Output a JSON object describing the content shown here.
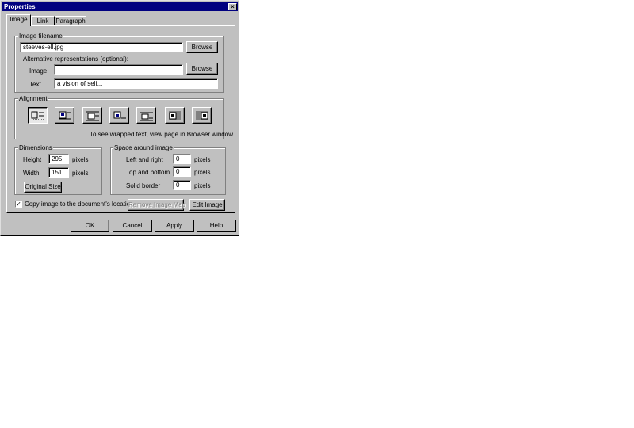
{
  "window": {
    "title": "Properties",
    "close_glyph": "×"
  },
  "tabs": [
    {
      "label": "Image"
    },
    {
      "label": "Link"
    },
    {
      "label": "Paragraph"
    }
  ],
  "filename_group": {
    "legend": "Image filename",
    "filename_value": "steeves-ell.jpg",
    "browse_label": "Browse",
    "alt_heading": "Alternative representations (optional):",
    "alt_image_label": "Image",
    "alt_image_value": "",
    "alt_browse_label": "Browse",
    "alt_text_label": "Text",
    "alt_text_value": "a vision of self..."
  },
  "alignment_group": {
    "legend": "Alignment",
    "buttons": [
      {
        "icon": "align-text-wrap-icon"
      },
      {
        "icon": "align-top-icon"
      },
      {
        "icon": "align-middle-icon"
      },
      {
        "icon": "align-bottom-icon"
      },
      {
        "icon": "align-baseline-icon"
      },
      {
        "icon": "align-left-wrap-icon"
      },
      {
        "icon": "align-right-wrap-icon"
      }
    ],
    "note": "To see wrapped text, view page in Browser window."
  },
  "dimensions_group": {
    "legend": "Dimensions",
    "height_label": "Height",
    "height_value": "295",
    "width_label": "Width",
    "width_value": "151",
    "unit": "pixels",
    "original_size_label": "Original Size"
  },
  "space_group": {
    "legend": "Space around image",
    "left_right_label": "Left and right",
    "left_right_value": "0",
    "top_bottom_label": "Top and bottom",
    "top_bottom_value": "0",
    "border_label": "Solid border",
    "border_value": "0",
    "unit": "pixels"
  },
  "copy_image": {
    "label": "Copy image to the document's location",
    "checked": true,
    "check_glyph": "✓"
  },
  "remove_map_label": "Remove Image Map",
  "edit_image_label": "Edit Image",
  "footer": {
    "ok_label": "OK",
    "cancel_label": "Cancel",
    "apply_label": "Apply",
    "help_label": "Help"
  }
}
